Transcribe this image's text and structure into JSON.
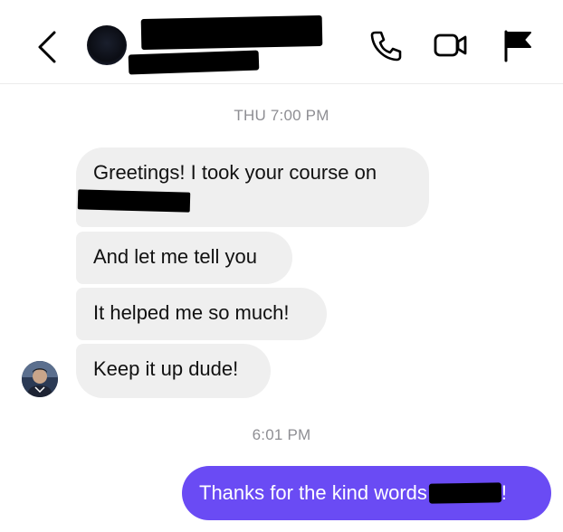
{
  "header": {
    "back_icon": "chevron-left-icon",
    "contact_name": "",
    "actions": [
      {
        "name": "call",
        "icon": "phone-icon"
      },
      {
        "name": "video",
        "icon": "video-camera-icon"
      },
      {
        "name": "report",
        "icon": "flag-icon"
      }
    ]
  },
  "thread": {
    "timestamp_1": "THU 7:00 PM",
    "timestamp_2": "6:01 PM",
    "incoming": [
      {
        "text": "Greetings! I took your course on"
      },
      {
        "text": "And let me tell you"
      },
      {
        "text": "It helped me so much!"
      },
      {
        "text": "Keep it up dude!"
      }
    ],
    "outgoing": [
      {
        "text_before": "Thanks for the kind words",
        "text_after": "!"
      }
    ]
  },
  "colors": {
    "incoming_bubble": "#efefef",
    "outgoing_bubble": "#6a4bf4",
    "timestamp": "#8e8e93",
    "redaction": "#000000"
  }
}
